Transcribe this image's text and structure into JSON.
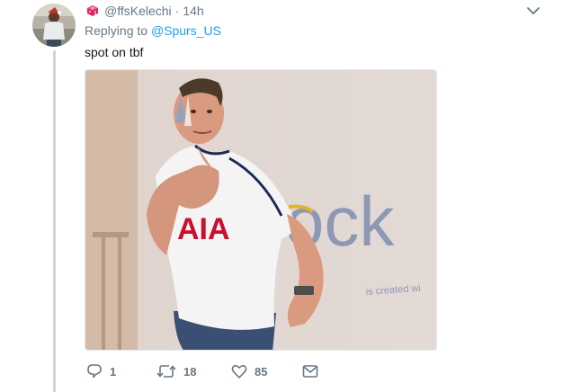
{
  "tweet": {
    "author_handle": "@ffsKelechi",
    "separator": "·",
    "timestamp": "14h",
    "replying_prefix": "Replying to",
    "replying_to": "@Spurs_US",
    "text": "spot on tbf"
  },
  "media": {
    "sign_text": "ock",
    "sign_subtext": "is created wi",
    "shirt_sponsor": "AIA"
  },
  "actions": {
    "reply_count": "1",
    "retweet_count": "18",
    "like_count": "85"
  },
  "icons": {
    "author_badge": "dice-icon",
    "menu": "chevron-down-icon",
    "reply": "reply-icon",
    "retweet": "retweet-icon",
    "like": "heart-icon",
    "dm": "envelope-icon"
  },
  "colors": {
    "link": "#1da1f2",
    "secondary_text": "#657786",
    "primary_text": "#14171a",
    "thread_line": "#ccd6dd",
    "badge": "#e0245e"
  }
}
